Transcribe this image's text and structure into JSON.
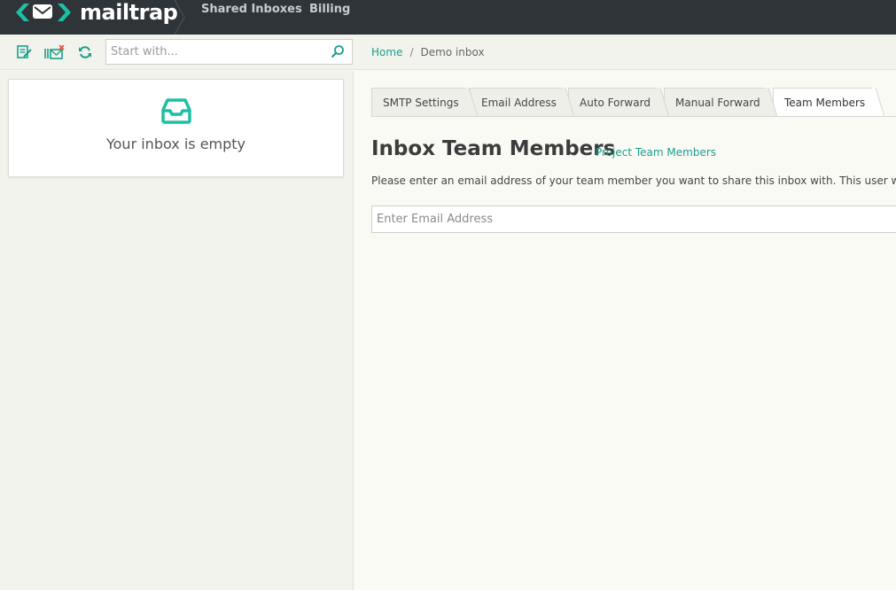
{
  "brand": {
    "name": "mailtrap",
    "accent": "#1fbfa4",
    "topbar_bg": "#2f3438"
  },
  "nav": {
    "items": [
      {
        "label": "Shared Inboxes"
      },
      {
        "label": "Billing"
      }
    ]
  },
  "toolbar": {
    "icons": [
      "edit-inbox-icon",
      "clear-inbox-icon",
      "refresh-icon"
    ],
    "search": {
      "placeholder": "Start with...",
      "value": ""
    }
  },
  "breadcrumb": {
    "home": "Home",
    "separator": "/",
    "current": "Demo inbox"
  },
  "inbox": {
    "empty_message": "Your inbox is empty",
    "empty_icon": "inbox-icon"
  },
  "tabs": [
    {
      "label": "SMTP Settings",
      "active": false
    },
    {
      "label": "Email Address",
      "active": false
    },
    {
      "label": "Auto Forward",
      "active": false
    },
    {
      "label": "Manual Forward",
      "active": false
    },
    {
      "label": "Team Members",
      "active": true
    }
  ],
  "team": {
    "title": "Inbox Team Members",
    "project_link": "Project Team Members",
    "description": "Please enter an email address of your team member you want to share this inbox with. This user will g",
    "email_placeholder": "Enter Email Address",
    "email_value": ""
  }
}
